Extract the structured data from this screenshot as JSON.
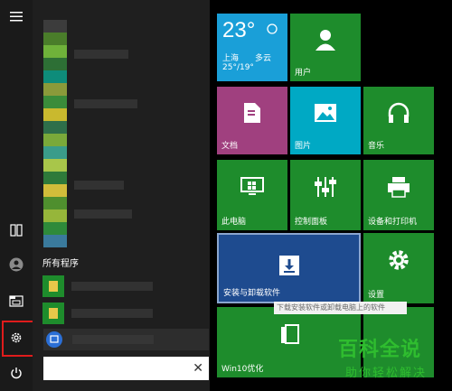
{
  "rail": {
    "items": [
      "menu-icon",
      "tablet-mode-icon",
      "user-icon",
      "file-explorer-icon",
      "gear-icon",
      "power-icon"
    ]
  },
  "applist": {
    "all_programs": "所有程序",
    "search_clear": "✕"
  },
  "tiles": {
    "weather": {
      "temp": "23°",
      "city": "上海",
      "cond": "多云",
      "range": "25°/19°"
    },
    "user": "用户",
    "documents": "文档",
    "pictures": "图片",
    "music": "音乐",
    "this_pc": "此电脑",
    "control_panel": "控制面板",
    "printers": "设备和打印机",
    "install_uninstall": "安装与卸载软件",
    "settings": "设置",
    "win10": "Win10优化"
  },
  "tooltip": "下载安装软件或卸载电脑上的软件",
  "watermark": {
    "title": "百科全说",
    "subtitle": "助你轻松解决"
  },
  "colors": {
    "tile_green": "#1e8c2c",
    "tile_blue": "#1a9fd8",
    "tile_purple": "#a0407f",
    "tile_cyan": "#00a9c4",
    "tile_navy": "#1e4b8f",
    "highlight_red": "#e01c1c"
  }
}
